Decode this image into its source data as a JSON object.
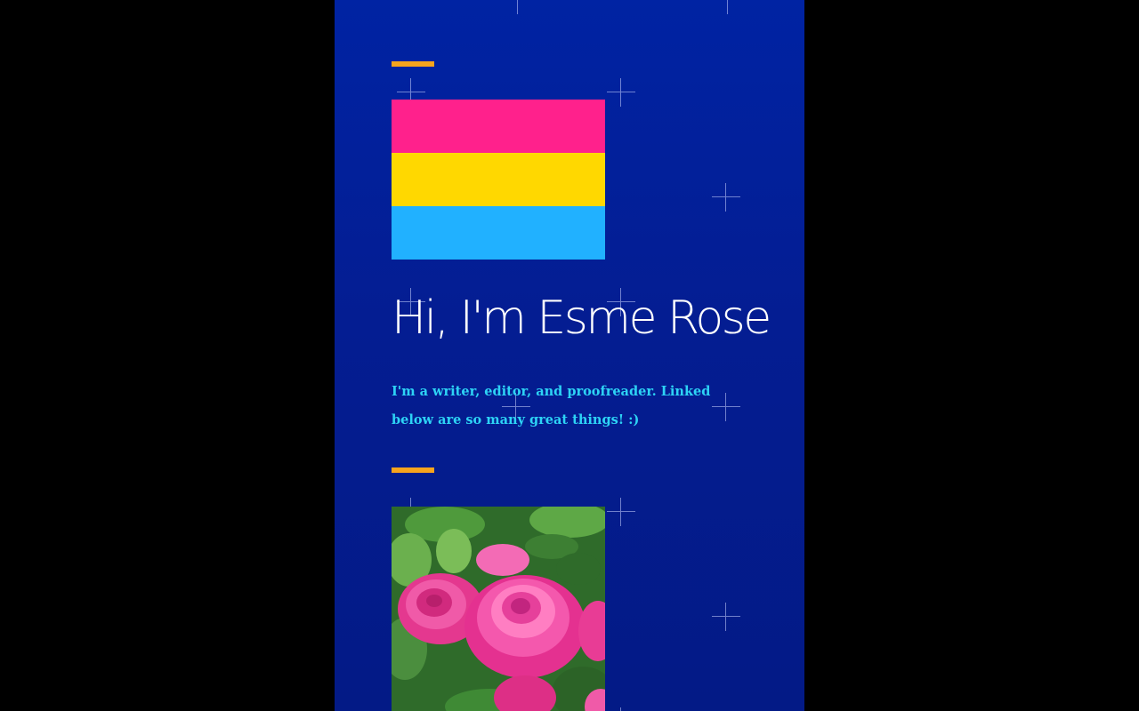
{
  "hero": {
    "flag_colors": [
      "#ff218c",
      "#ffd800",
      "#21b1ff"
    ],
    "headline": "Hi, I'm Esme Rose",
    "intro": "I'm a writer, editor, and proofreader. Linked below are so many great things! :)"
  },
  "photo": {
    "subject": "pink-roses-photo"
  },
  "colors": {
    "background": "#041d92",
    "accent": "#f7a41d",
    "headline": "#ffffff",
    "intro_text": "#2dd3f5",
    "outside": "#000000"
  }
}
